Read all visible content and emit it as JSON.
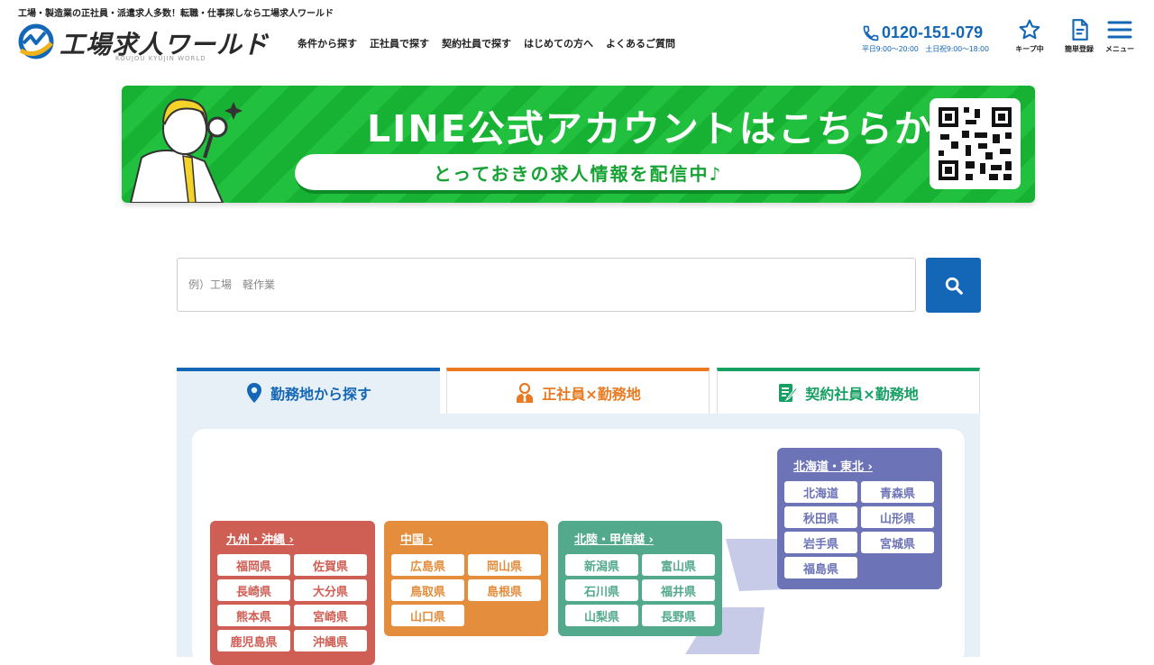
{
  "header": {
    "tagline": "工場・製造業の正社員・派遣求人多数！転職・仕事探しなら工場求人ワールド",
    "logo_text": "工場求人ワールド",
    "logo_sub": "KOUJOU KYUJIN WORLD",
    "nav": [
      "条件から探す",
      "正社員で探す",
      "契約社員で探す",
      "はじめての方へ",
      "よくあるご質問"
    ],
    "phone": "0120-151-079",
    "hours": "平日9:00〜20:00　土日祝9:00〜18:00",
    "keep_label": "キープ中",
    "register_label": "簡単登録",
    "menu_label": "メニュー"
  },
  "banner": {
    "headline": "LINE公式アカウントはこちらから！",
    "subline": "とっておきの求人情報を配信中♪"
  },
  "search": {
    "placeholder": "例）工場　軽作業"
  },
  "tabs": [
    {
      "label": "勤務地から探す"
    },
    {
      "label": "正社員×勤務地"
    },
    {
      "label": "契約社員×勤務地"
    }
  ],
  "regions": {
    "kyushu": {
      "title": "九州・沖縄",
      "prefs": [
        "福岡県",
        "佐賀県",
        "長崎県",
        "大分県",
        "熊本県",
        "宮崎県",
        "鹿児島県",
        "沖縄県"
      ]
    },
    "chugoku": {
      "title": "中国",
      "prefs": [
        "広島県",
        "岡山県",
        "鳥取県",
        "島根県",
        "山口県"
      ]
    },
    "hokuriku": {
      "title": "北陸・甲信越",
      "prefs": [
        "新潟県",
        "富山県",
        "石川県",
        "福井県",
        "山梨県",
        "長野県"
      ]
    },
    "hokkaido": {
      "title": "北海道・東北",
      "prefs": [
        "北海道",
        "青森県",
        "秋田県",
        "山形県",
        "岩手県",
        "宮城県",
        "福島県"
      ]
    }
  },
  "colors": {
    "brand_blue": "#1467b7",
    "line_green": "#17b233",
    "orange": "#ea7a22",
    "teal": "#17a064"
  }
}
